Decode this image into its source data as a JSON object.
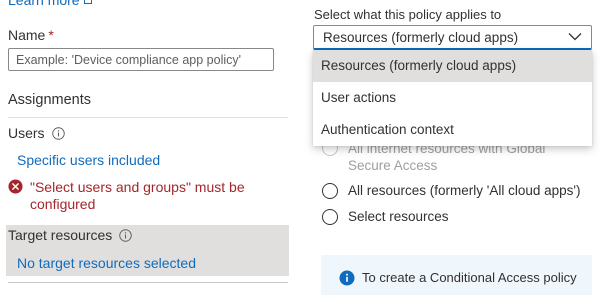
{
  "left": {
    "learn_more": "Learn more",
    "name_label": "Name",
    "required_marker": "*",
    "name_placeholder": "Example: 'Device compliance app policy'",
    "assignments_heading": "Assignments",
    "users_label": "Users",
    "users_value": "Specific users included",
    "error_message": "\"Select users and groups\" must be configured",
    "target_label": "Target resources",
    "target_value": "No target resources selected"
  },
  "right": {
    "select_label": "Select what this policy applies to",
    "select_value": "Resources (formerly cloud apps)",
    "options": [
      "Resources (formerly cloud apps)",
      "User actions",
      "Authentication context"
    ],
    "radios": [
      "All internet resources with Global Secure Access",
      "All resources (formerly 'All cloud apps')",
      "Select resources"
    ],
    "info_text": "To create a Conditional Access policy"
  },
  "colors": {
    "link": "#0f6cbd",
    "error": "#a4262c",
    "selected_bg": "#e1dfdd",
    "info_bg": "#eff6fc"
  }
}
